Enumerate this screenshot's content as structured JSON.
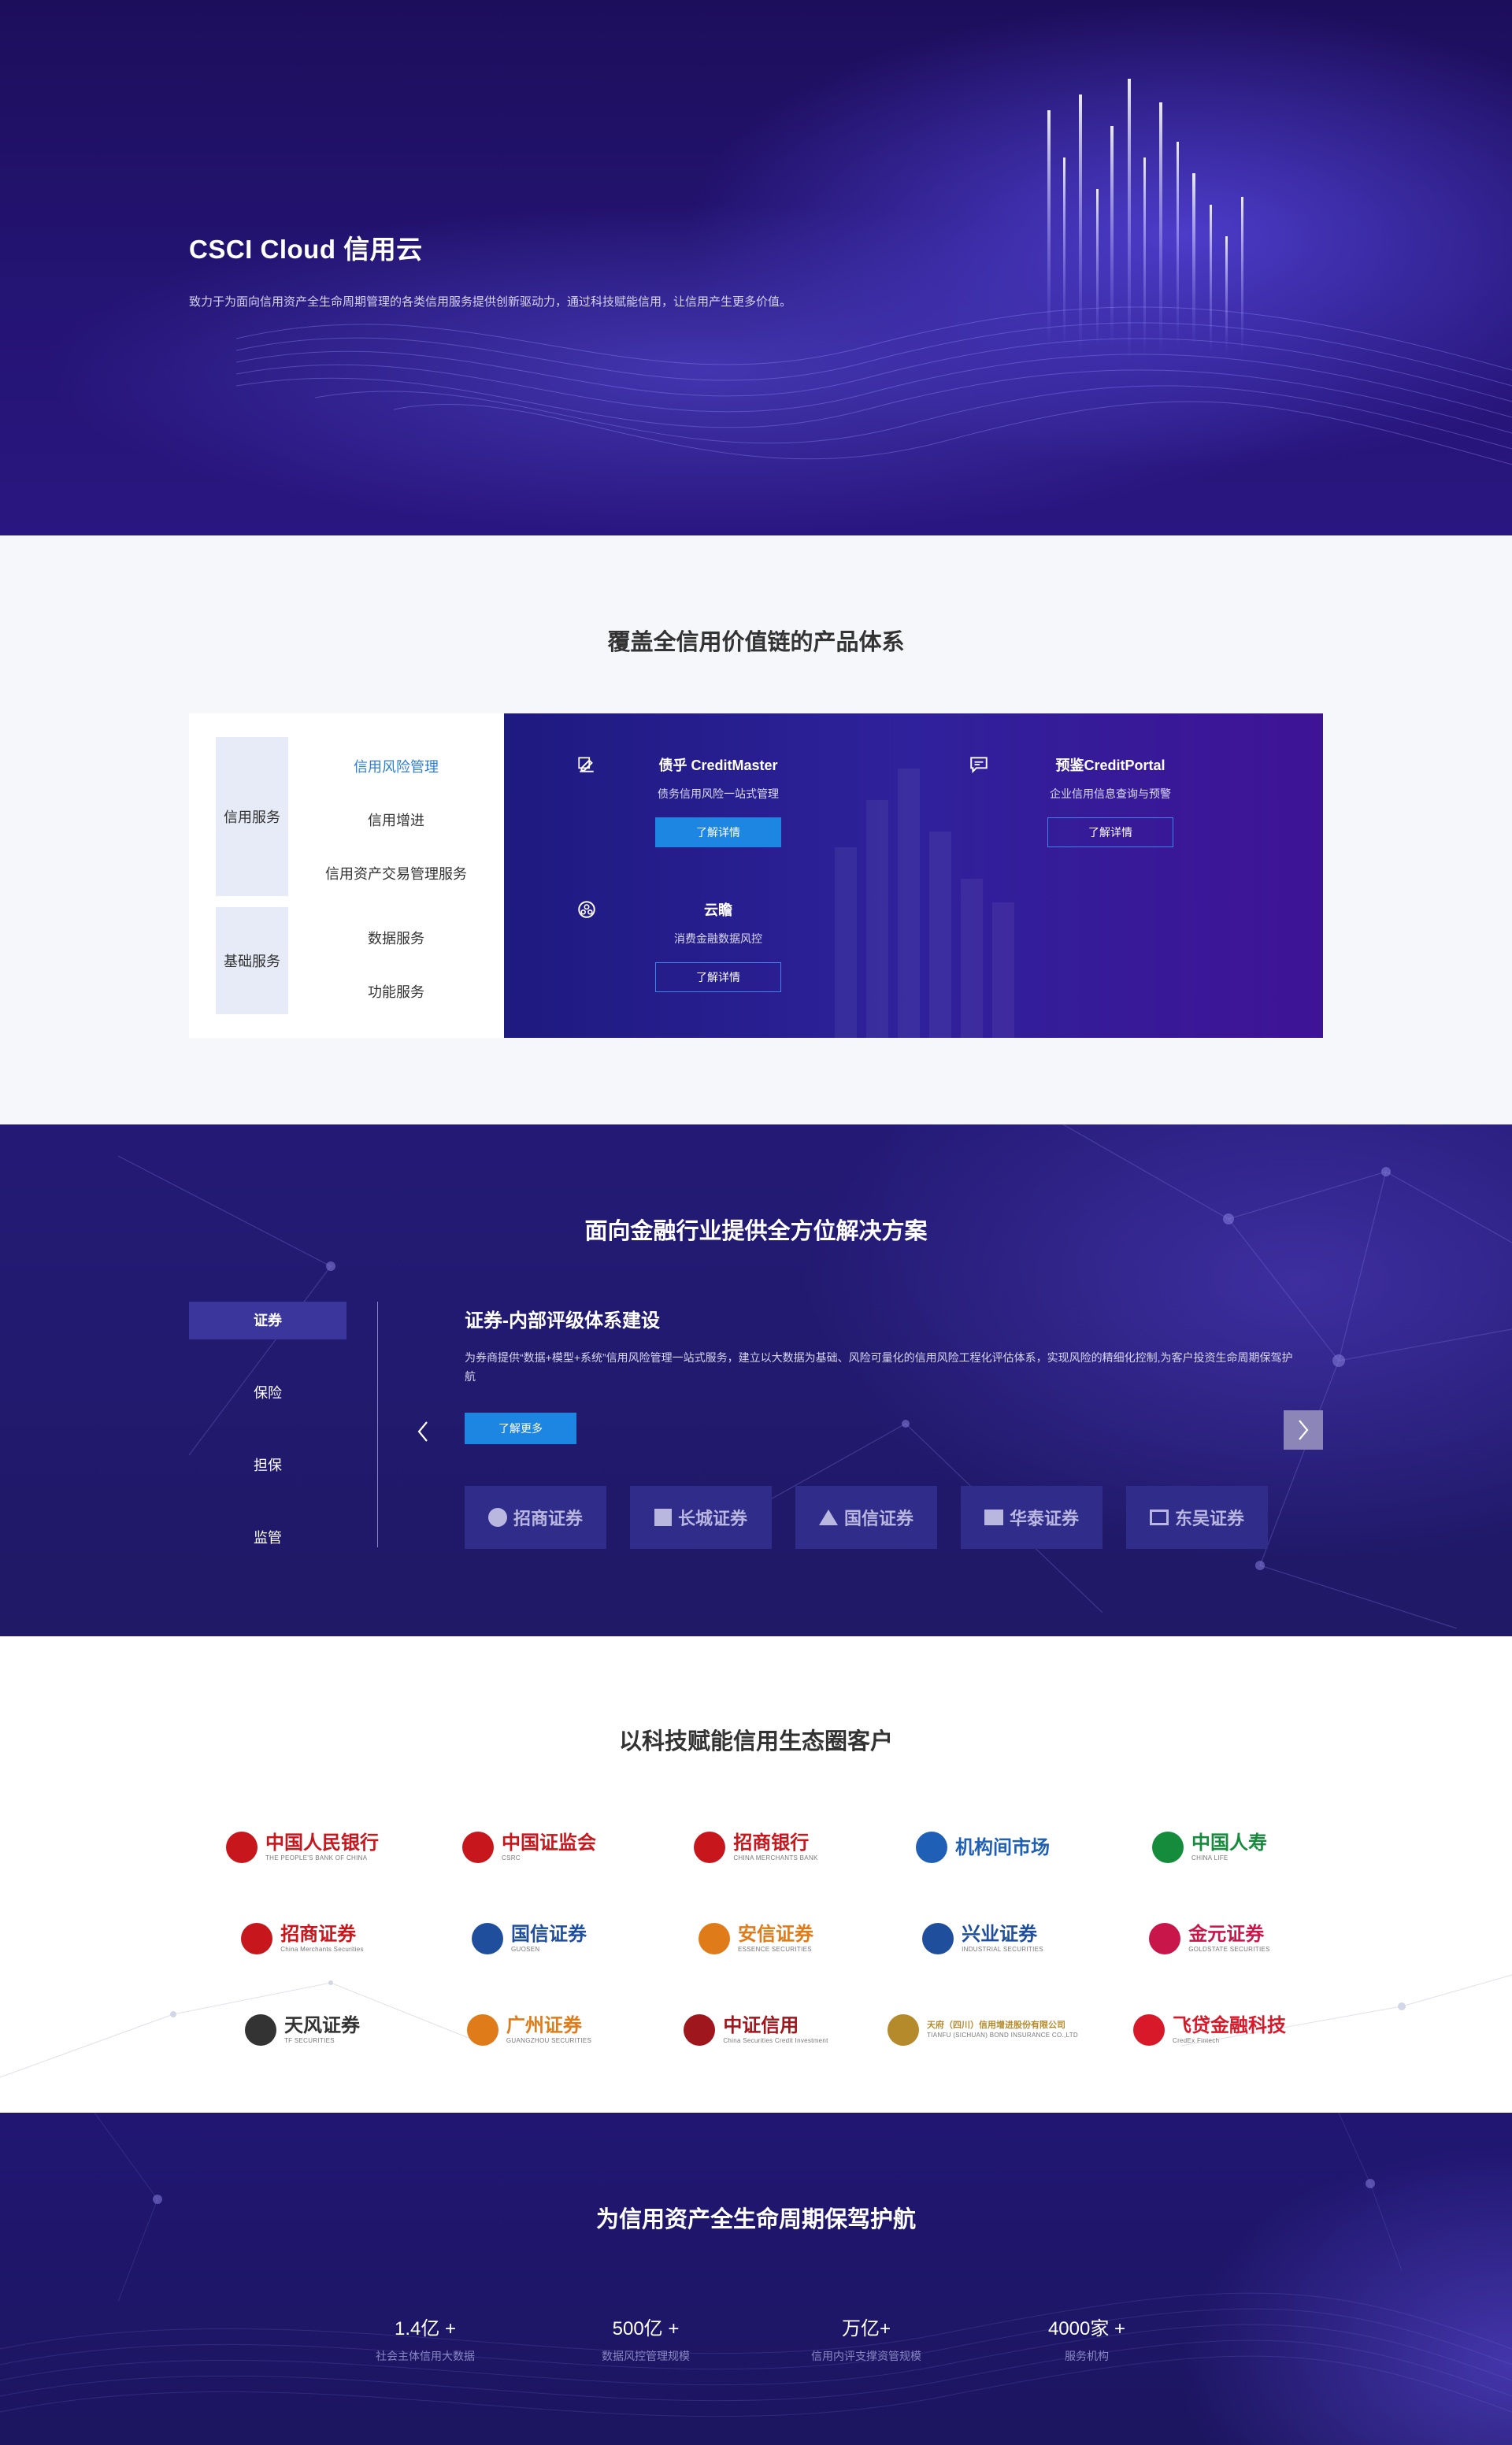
{
  "hero": {
    "title": "CSCI Cloud 信用云",
    "description": "致力于为面向信用资产全生命周期管理的各类信用服务提供创新驱动力，通过科技赋能信用，让信用产生更多价值。"
  },
  "products": {
    "section_title": "覆盖全信用价值链的产品体系",
    "groups": [
      {
        "label": "信用服务",
        "items": [
          "信用风险管理",
          "信用增进",
          "信用资产交易管理服务"
        ]
      },
      {
        "label": "基础服务",
        "items": [
          "数据服务",
          "功能服务"
        ]
      }
    ],
    "active_item": "信用风险管理",
    "cards": [
      {
        "icon": "edit-icon",
        "title": "债乎 CreditMaster",
        "subtitle": "债务信用风险一站式管理",
        "button": "了解详情"
      },
      {
        "icon": "message-icon",
        "title": "预鉴CreditPortal",
        "subtitle": "企业信用信息查询与预警",
        "button": "了解详情"
      },
      {
        "icon": "cloud-people-icon",
        "title": "云瞻",
        "subtitle": "消费金融数据风控",
        "button": "了解详情"
      }
    ]
  },
  "solutions": {
    "section_title": "面向金融行业提供全方位解决方案",
    "tabs": [
      "证券",
      "保险",
      "担保",
      "监管"
    ],
    "active_tab": "证券",
    "detail_title": "证券-内部评级体系建设",
    "detail_description": "为券商提供“数据+模型+系统”信用风险管理一站式服务，建立以大数据为基础、风险可量化的信用风险工程化评估体系，实现风险的精细化控制,为客户投资生命周期保驾护航",
    "button": "了解更多",
    "partner_logos": [
      "招商证券",
      "长城证券",
      "国信证券",
      "华泰证券",
      "东吴证券"
    ],
    "colors": {
      "button": "#1c86e2",
      "tab_active": "#3a369c"
    }
  },
  "clients": {
    "section_title": "以科技赋能信用生态圈客户",
    "items": [
      {
        "name": "中国人民银行",
        "en": "THE PEOPLE'S BANK OF CHINA",
        "color": "#c8161d"
      },
      {
        "name": "中国证监会",
        "en": "CSRC",
        "color": "#c8161d"
      },
      {
        "name": "招商银行",
        "en": "CHINA MERCHANTS BANK",
        "color": "#c8161d"
      },
      {
        "name": "机构间市场",
        "en": "",
        "color": "#1f5fb5"
      },
      {
        "name": "中国人寿",
        "en": "CHINA LIFE",
        "color": "#158b3c"
      },
      {
        "name": "招商证券",
        "en": "China Merchants Securities",
        "color": "#c8161d"
      },
      {
        "name": "国信证券",
        "en": "GUOSEN",
        "color": "#1f4f9c"
      },
      {
        "name": "安信证券",
        "en": "ESSENCE SECURITIES",
        "color": "#e07b1a"
      },
      {
        "name": "兴业证券",
        "en": "INDUSTRIAL SECURITIES",
        "color": "#1f4f9c"
      },
      {
        "name": "金元证券",
        "en": "GOLDSTATE SECURITIES",
        "color": "#c8164a"
      },
      {
        "name": "天风证券",
        "en": "TF SECURITIES",
        "color": "#333333"
      },
      {
        "name": "广州证券",
        "en": "GUANGZHOU SECURITIES",
        "color": "#e07b1a"
      },
      {
        "name": "中证信用",
        "en": "China Securities Credit Investment",
        "color": "#a0161d"
      },
      {
        "name": "天府（四川）信用增进股份有限公司",
        "en": "TIANFU (SICHUAN) BOND INSURANCE CO.,LTD",
        "color": "#b58a2a"
      },
      {
        "name": "飞贷金融科技",
        "en": "CredEx Fintech",
        "color": "#d8192a"
      }
    ]
  },
  "stats": {
    "section_title": "为信用资产全生命周期保驾护航",
    "items": [
      {
        "value": "1.4亿 +",
        "label": "社会主体信用大数据"
      },
      {
        "value": "500亿 +",
        "label": "数据风控管理规模"
      },
      {
        "value": "万亿+",
        "label": "信用内评支撑资管规模"
      },
      {
        "value": "4000家 +",
        "label": "服务机构"
      }
    ]
  }
}
